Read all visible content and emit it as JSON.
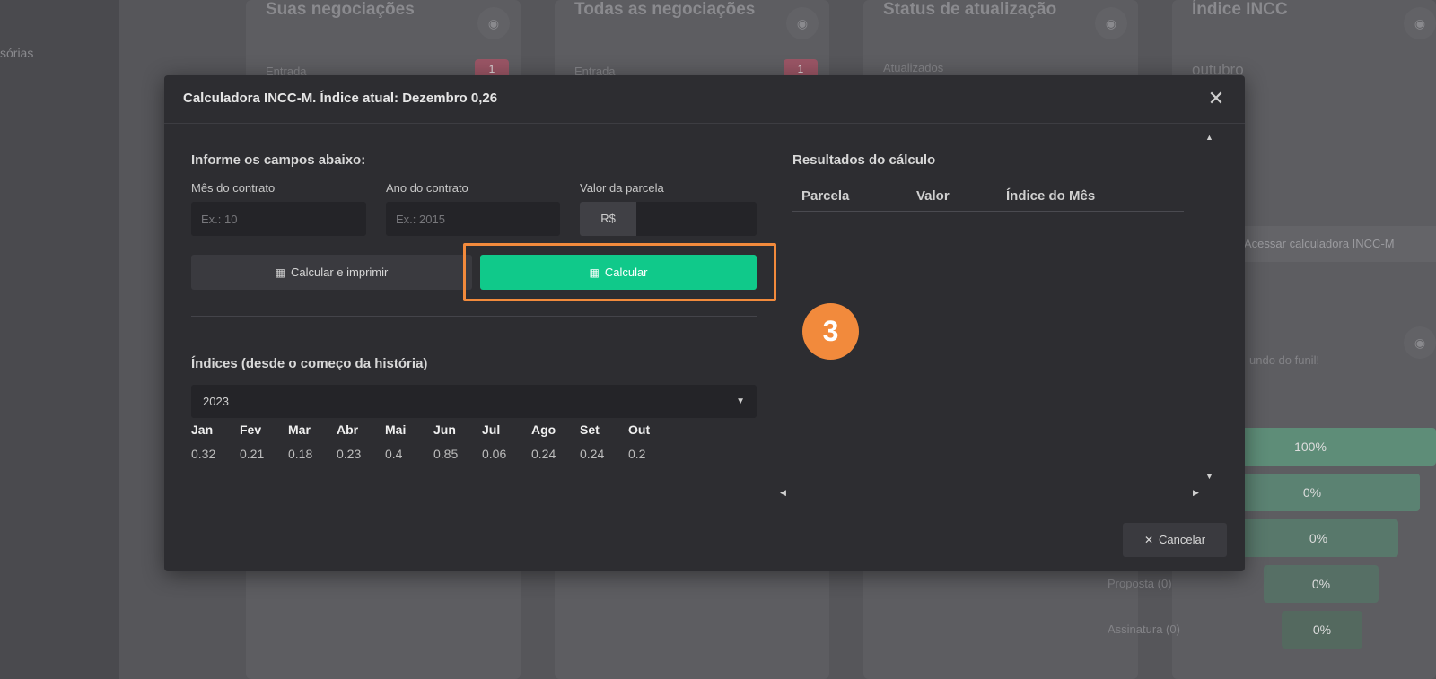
{
  "background": {
    "sidebar_text": "sórias",
    "cards": [
      {
        "title": "Suas negociações",
        "sub": "Entrada",
        "badge": "1"
      },
      {
        "title": "Todas as negociações",
        "sub": "Entrada",
        "badge": "1"
      },
      {
        "title": "Status de atualização",
        "sub": "Atualizados"
      },
      {
        "title": "Índice INCC",
        "sub": "outubro"
      }
    ],
    "calc_link": "Acessar calculadora INCC-M",
    "funnel_hint": "undo do funil!",
    "funnel": [
      {
        "label": "",
        "value": "100%"
      },
      {
        "label": "",
        "value": "0%"
      },
      {
        "label": "",
        "value": "0%"
      },
      {
        "label": "Proposta (0)",
        "value": "0%"
      },
      {
        "label": "Assinatura (0)",
        "value": "0%"
      }
    ]
  },
  "modal": {
    "title": "Calculadora INCC-M. Índice atual: Dezembro 0,26",
    "close_icon": "close-icon",
    "form_heading": "Informe os campos abaixo:",
    "fields": {
      "month": {
        "label": "Mês do contrato",
        "placeholder": "Ex.: 10"
      },
      "year": {
        "label": "Ano do contrato",
        "placeholder": "Ex.: 2015"
      },
      "installment": {
        "label": "Valor da parcela",
        "addon": "R$"
      }
    },
    "buttons": {
      "print": "Calcular e imprimir",
      "calculate": "Calcular",
      "cancel": "Cancelar"
    },
    "step_number": "3",
    "history_heading": "Índices (desde o começo da história)",
    "selected_year": "2023",
    "months": [
      "Jan",
      "Fev",
      "Mar",
      "Abr",
      "Mai",
      "Jun",
      "Jul",
      "Ago",
      "Set",
      "Out"
    ],
    "values": [
      "0.32",
      "0.21",
      "0.18",
      "0.23",
      "0.4",
      "0.85",
      "0.06",
      "0.24",
      "0.24",
      "0.2"
    ],
    "results_heading": "Resultados do cálculo",
    "results_columns": [
      "Parcela",
      "Valor",
      "Índice do Mês"
    ]
  },
  "colors": {
    "accent_green": "#10c98a",
    "highlight_orange": "#f28a3c"
  }
}
